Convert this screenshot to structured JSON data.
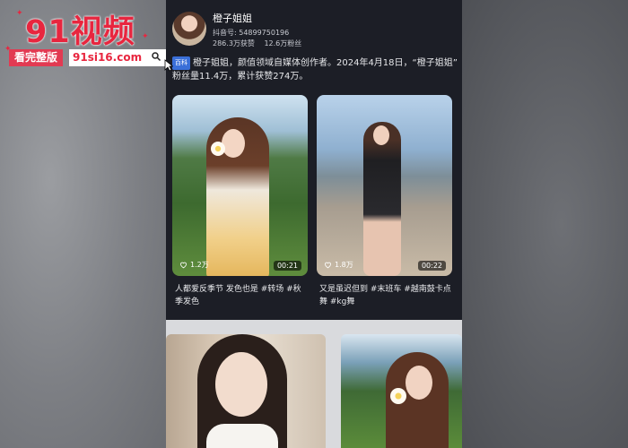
{
  "watermark": {
    "title": "91视频",
    "subtitle": "看完整版",
    "url": "91si16.com"
  },
  "profile": {
    "name": "橙子姐姐",
    "account_id": "抖音号: 54899750196",
    "likes": "286.3万获赞",
    "followers": "12.6万粉丝"
  },
  "description": {
    "tag": "百科",
    "text_line1": "橙子姐姐，颜值领域自媒体创作者。2024年4月18日，“橙子姐姐”",
    "text_line2": "粉丝量11.4万，累计获赞274万。"
  },
  "videos": [
    {
      "likes": "1.2万",
      "duration": "00:21",
      "caption": "人都爱反季节 发色也是 #转场 #秋季发色"
    },
    {
      "likes": "1.8万",
      "duration": "00:22",
      "caption": "又是虽迟但到 #末班车 #越南鼓卡点舞 #kg舞"
    }
  ],
  "icons": {
    "heart": "heart-icon",
    "search": "search-icon",
    "cursor": "cursor-icon",
    "avatar": "avatar-image"
  },
  "colors": {
    "brand_red": "#e8263f",
    "page_bg": "#1c1e26",
    "tag_blue": "#3a6fd8"
  }
}
